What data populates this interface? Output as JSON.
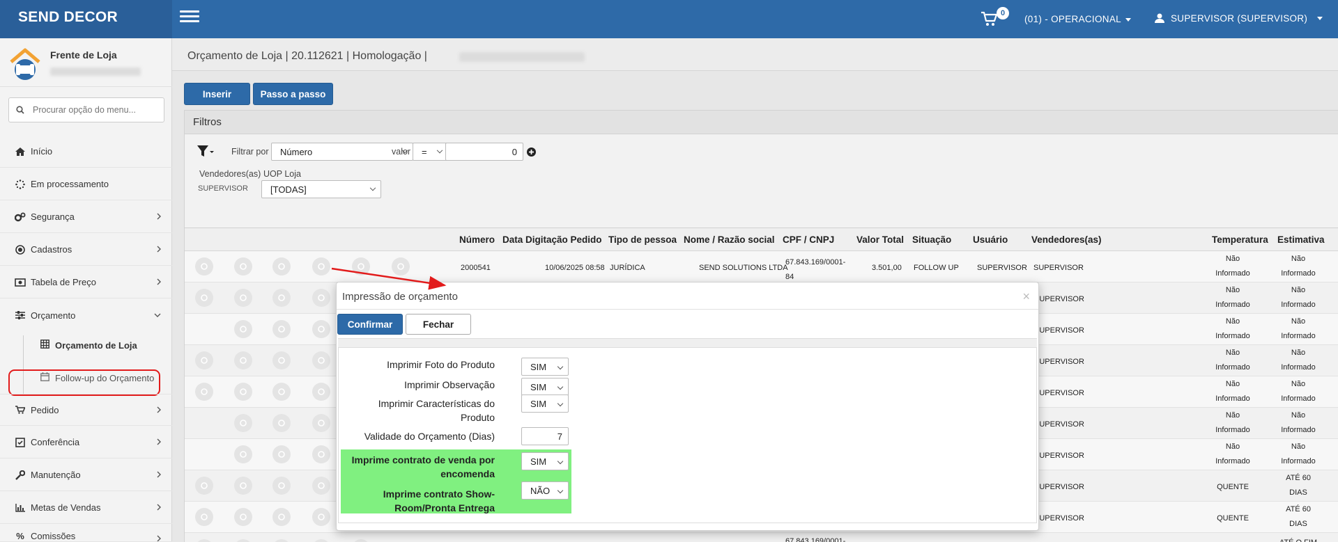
{
  "header": {
    "brand": "SEND DECOR",
    "cart_count": "0",
    "unit": "(01) - OPERACIONAL",
    "user": "SUPERVISOR (SUPERVISOR)"
  },
  "sidebar": {
    "profile_name": "Frente de Loja",
    "search_placeholder": "Procurar opção do menu...",
    "items": [
      {
        "label": "Início",
        "icon": "home-icon"
      },
      {
        "label": "Em processamento",
        "icon": "spinner-icon"
      },
      {
        "label": "Segurança",
        "icon": "gears-icon"
      },
      {
        "label": "Cadastros",
        "icon": "target-icon"
      },
      {
        "label": "Tabela de Preço",
        "icon": "money-icon"
      },
      {
        "label": "Orçamento",
        "icon": "sliders-icon"
      },
      {
        "label": "Pedido",
        "icon": "cart-icon"
      },
      {
        "label": "Conferência",
        "icon": "check-square-icon"
      },
      {
        "label": "Manutenção",
        "icon": "wrench-icon"
      },
      {
        "label": "Metas de Vendas",
        "icon": "bar-chart-icon"
      },
      {
        "label": "Comissões",
        "icon": "percent-icon"
      }
    ],
    "subitems": [
      {
        "label": "Orçamento de Loja",
        "icon": "table-icon"
      },
      {
        "label": "Follow-up do Orçamento",
        "icon": "calendar-icon"
      }
    ]
  },
  "page": {
    "title": "Orçamento de Loja | 20.112621 | Homologação |",
    "insert_label": "Inserir",
    "step_label": "Passo a passo"
  },
  "filters": {
    "title": "Filtros",
    "filter_by_label": "Filtrar por",
    "filter_by_value": "Número",
    "value_label": "valor",
    "operator": "=",
    "value": "0",
    "sellers_label": "Vendedores(as)",
    "sellers_value": "SUPERVISOR",
    "uop_label": "UOP Loja",
    "uop_value": "[TODAS]"
  },
  "table": {
    "headers": [
      "Número",
      "Data Digitação Pedido",
      "Tipo de pessoa",
      "Nome / Razão social",
      "CPF / CNPJ",
      "Valor Total",
      "Situação",
      "Usuário",
      "Vendedores(as)",
      "Temperatura",
      "Estimativa"
    ],
    "row1": {
      "numero": "2000541",
      "data": "10/06/2025 08:58",
      "tipo": "JURÍDICA",
      "nome": "SEND SOLUTIONS LTDA",
      "cnpj_a": "67.843.169/0001-",
      "cnpj_b": "84",
      "valor": "3.501,00",
      "situacao": "FOLLOW UP",
      "usuario": "SUPERVISOR",
      "vendedor": "SUPERVISOR"
    },
    "vendedor": "SUPERVISOR",
    "temp_ni_a": "Não",
    "temp_ni_b": "Informado",
    "temp_hot": "QUENTE",
    "est_60_a": "ATÉ 60",
    "est_60_b": "DIAS",
    "last_cnpj": "67.843.169/0001-",
    "last_est": "ATÉ O FIM"
  },
  "modal": {
    "title": "Impressão de orçamento",
    "close": "×",
    "confirm_label": "Confirmar",
    "close_label": "Fechar",
    "fields": [
      {
        "label": "Imprimir Foto do Produto",
        "value": "SIM"
      },
      {
        "label": "Imprimir Observação",
        "value": "SIM"
      },
      {
        "label": "Imprimir Características do Produto",
        "value": "SIM"
      },
      {
        "label": "Validade do Orçamento (Dias)",
        "value": "7"
      },
      {
        "label": "Imprime contrato de venda por encomenda",
        "value": "SIM"
      },
      {
        "label": "Imprime contrato Show-Room/Pronta Entrega",
        "value": "NÃO"
      }
    ]
  },
  "colors": {
    "primary": "#2e6aa8",
    "highlight_green": "#80f080",
    "annotation_red": "#e21b1b"
  }
}
